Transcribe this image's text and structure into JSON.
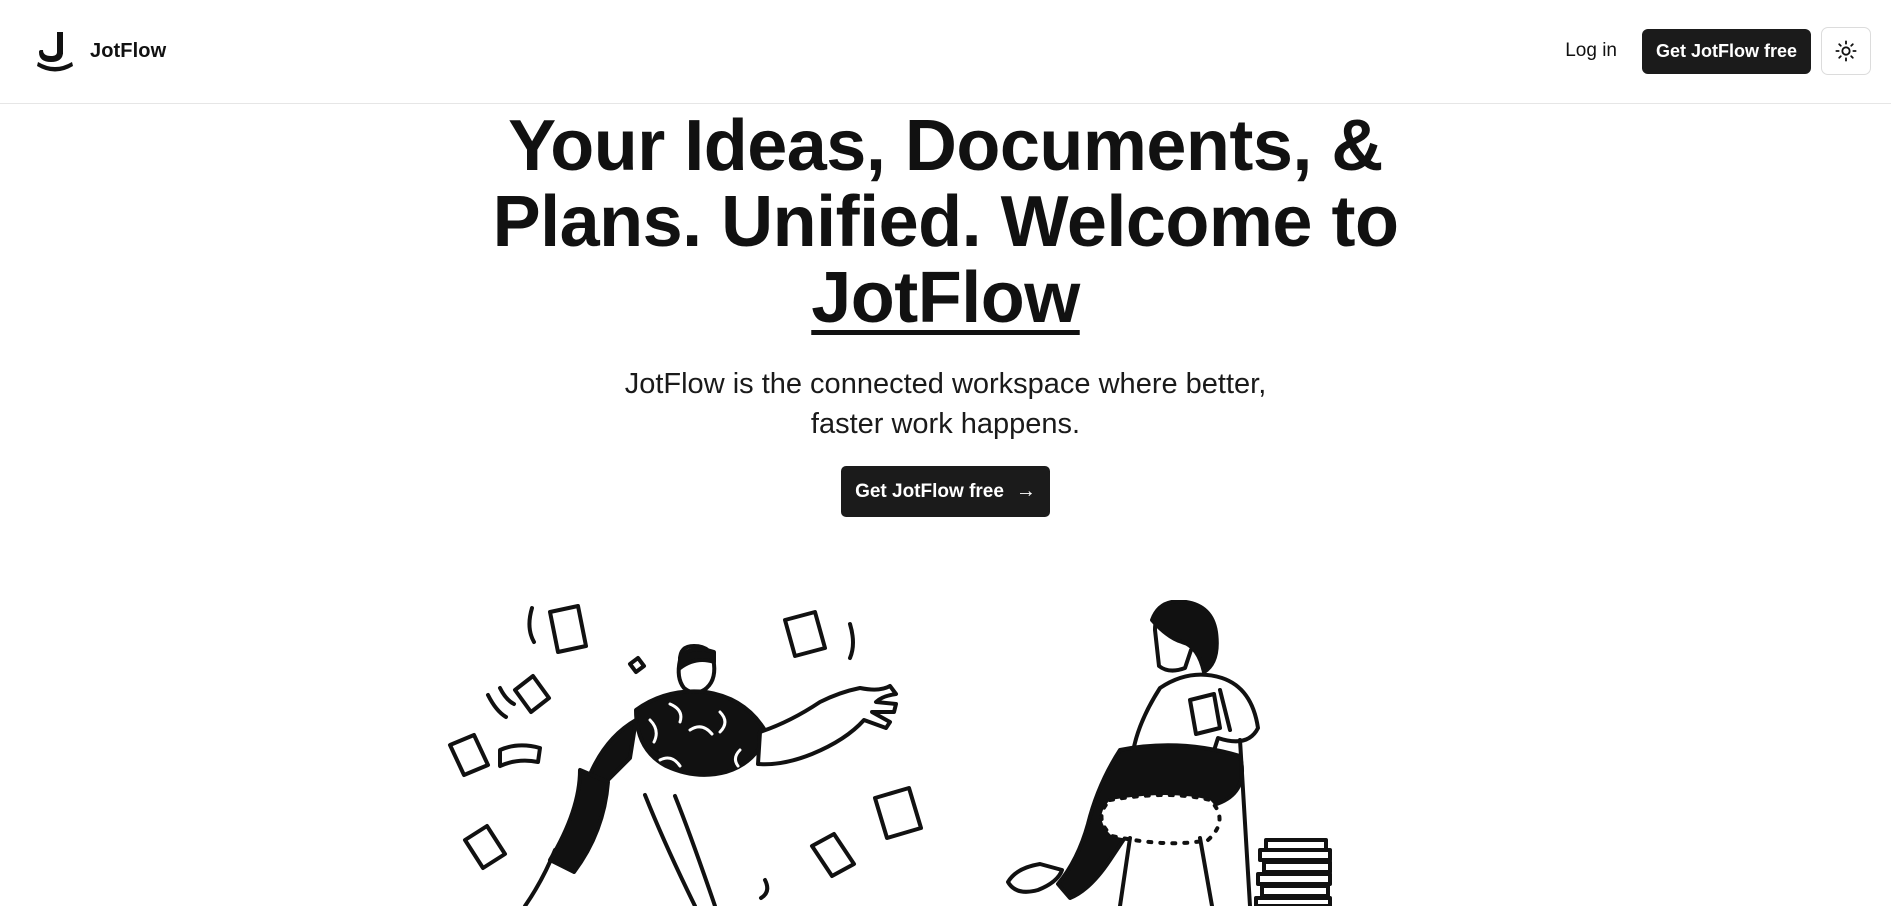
{
  "nav": {
    "brand_name": "JotFlow",
    "login_label": "Log in",
    "cta_label": "Get JotFlow free",
    "theme_icon": "sun-icon"
  },
  "hero": {
    "title_prefix": "Your Ideas, Documents, & Plans. Unified. Welcome to ",
    "title_brand": "JotFlow",
    "subtitle": "JotFlow is the connected workspace where better, faster work happens.",
    "cta_label": "Get JotFlow free",
    "cta_icon": "arrow-right-icon"
  },
  "colors": {
    "primary": "#1b1b1b",
    "text": "#111111",
    "background": "#ffffff",
    "border": "#e6e6e6"
  }
}
